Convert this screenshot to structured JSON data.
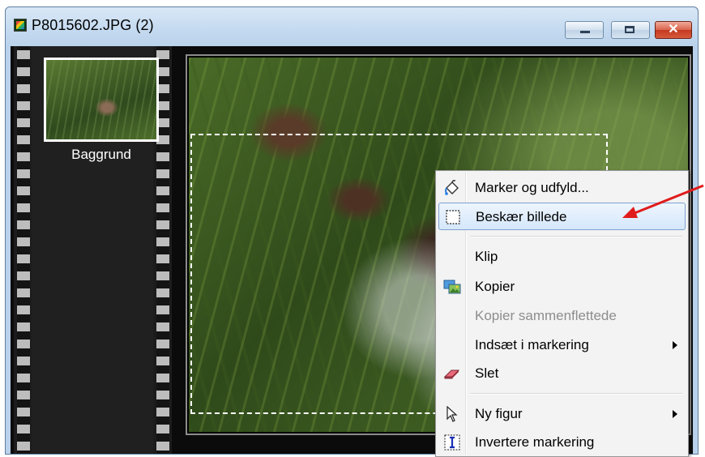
{
  "window": {
    "title": "P8015602.JPG (2)",
    "controls": [
      "minimize-button",
      "maximize-button",
      "close-button"
    ]
  },
  "layers": [
    {
      "label": "Baggrund"
    }
  ],
  "context_menu": {
    "items": [
      {
        "label": "Marker og udfyld...",
        "icon": "paint-bucket-icon",
        "enabled": true
      },
      {
        "label": "Beskær billede",
        "icon": "crop-selection-icon",
        "enabled": true,
        "highlighted": true
      },
      {
        "label": "Klip",
        "enabled": true
      },
      {
        "label": "Kopier",
        "icon": "copy-images-icon",
        "enabled": true
      },
      {
        "label": "Kopier sammenflettede",
        "enabled": false
      },
      {
        "label": "Indsæt i markering",
        "enabled": true,
        "submenu": true
      },
      {
        "label": "Slet",
        "icon": "eraser-icon",
        "enabled": true
      },
      {
        "label": "Ny figur",
        "icon": "pointer-arrow-icon",
        "enabled": true,
        "submenu": true
      },
      {
        "label": "Invertere markering",
        "icon": "invert-selection-icon",
        "enabled": true
      }
    ]
  },
  "colors": {
    "highlight_border": "#7da2ce",
    "annotation_arrow": "#e01b1b",
    "close_button": "#c5391f"
  }
}
